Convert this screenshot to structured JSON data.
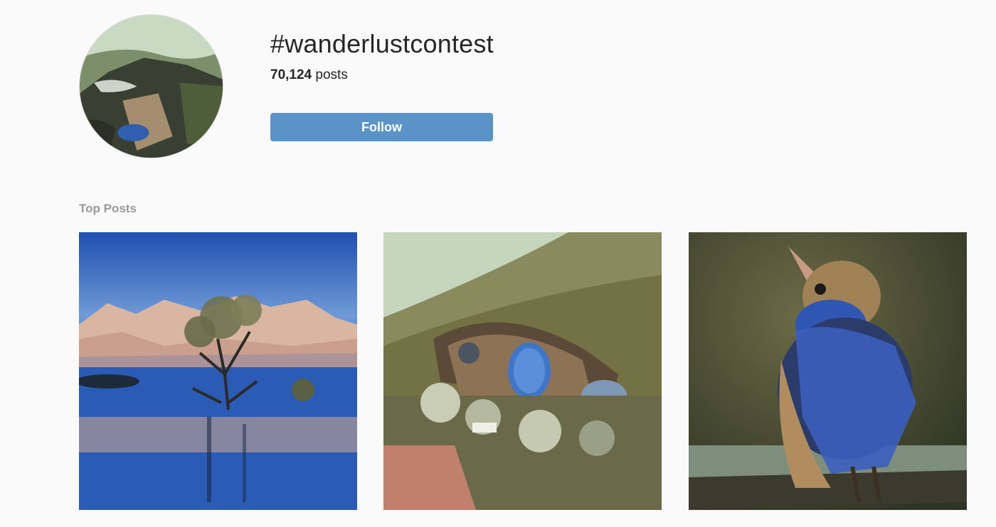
{
  "hashtag": {
    "title": "#wanderlustcontest",
    "post_count": "70,124",
    "post_count_suffix": " posts",
    "follow_label": "Follow"
  },
  "top_posts": {
    "heading": "Top Posts",
    "items": [
      {
        "subject": "lone tree in lake with snowy mountains"
      },
      {
        "subject": "hobbit hole with round blue door"
      },
      {
        "subject": "kingfisher bird perched on branch"
      }
    ]
  },
  "colors": {
    "follow_button": "#5a93c7",
    "heading_muted": "#999999",
    "text": "#262626",
    "background": "#fafafa"
  }
}
